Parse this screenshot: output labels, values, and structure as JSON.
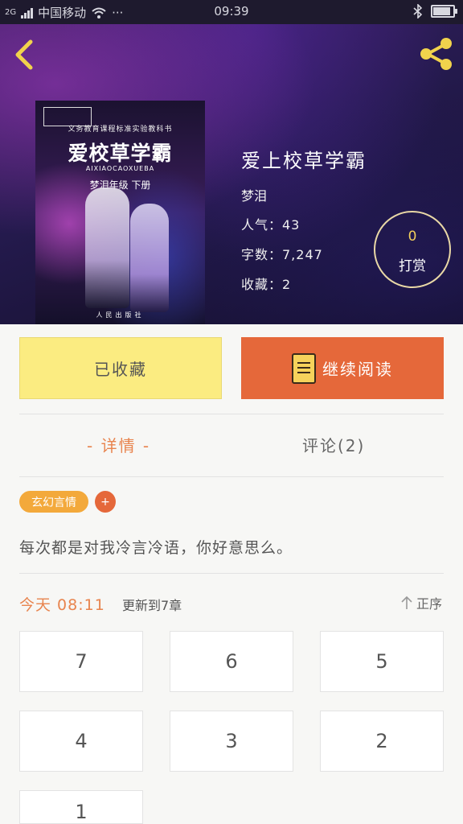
{
  "status_bar": {
    "carrier": "中国移动",
    "network": "2G",
    "more": "···",
    "time": "09:39",
    "battery_level": 0.8
  },
  "header": {
    "back_icon": "chevron-left-icon",
    "share_icon": "share-icon"
  },
  "cover": {
    "series": "义务教育课程标准实验教科书",
    "title": "爱校草学霸",
    "pinyin": "AIXIAOCAOXUEBA",
    "grade": "梦泪年级 下册",
    "publisher": "人民出版社"
  },
  "book": {
    "title": "爱上校草学霸",
    "author": "梦泪",
    "popularity": "人气：43",
    "word_count": "字数：7,247",
    "favorites": "收藏：2"
  },
  "tip": {
    "count": "0",
    "label": "打赏"
  },
  "actions": {
    "favorite_label": "已收藏",
    "read_label": "继续阅读"
  },
  "tabs": [
    {
      "label": "- 详情 -",
      "active": true
    },
    {
      "label": "评论(2)",
      "active": false
    }
  ],
  "tag": {
    "label": "玄幻言情",
    "add": "+"
  },
  "synopsis": "每次都是对我冷言冷语，你好意思么。",
  "update": {
    "time": "今天 08:11",
    "text": "更新到7章",
    "sort_label": "正序"
  },
  "chapters": [
    "7",
    "6",
    "5",
    "4",
    "3",
    "2",
    "1"
  ],
  "colors": {
    "accent": "#e5683a",
    "tab_active": "#e8844e",
    "favorite_bg": "#fbec81",
    "tag_bg": "#f3a93b"
  }
}
